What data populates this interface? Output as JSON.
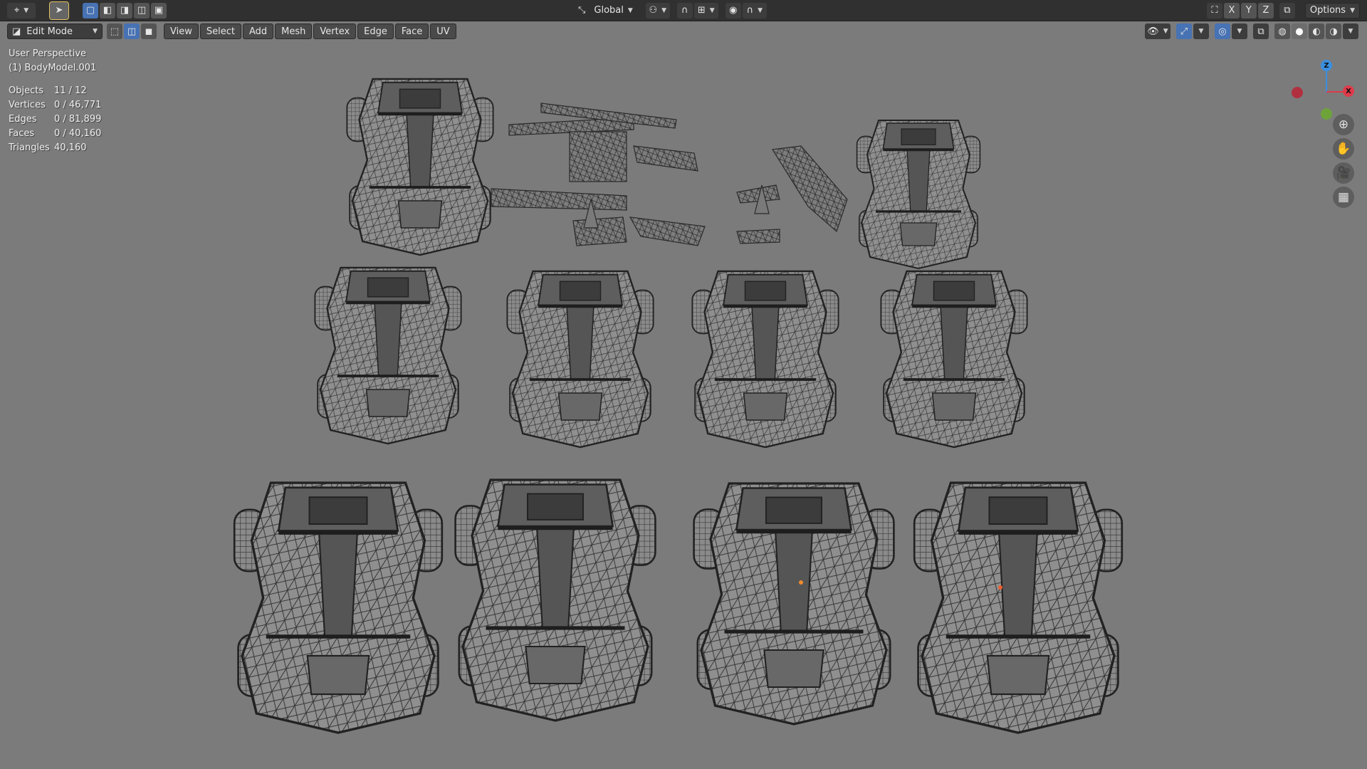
{
  "app": {
    "topbar": {
      "transform_orientation": "Global",
      "axes": [
        "X",
        "Y",
        "Z"
      ],
      "options_label": "Options"
    },
    "header": {
      "mode": "Edit Mode",
      "menus": [
        "View",
        "Select",
        "Add",
        "Mesh",
        "Vertex",
        "Edge",
        "Face",
        "UV"
      ]
    },
    "viewport": {
      "perspective_label": "User Perspective",
      "active_object": "(1) BodyModel.001",
      "stats": [
        {
          "key": "Objects",
          "value": "11 / 12"
        },
        {
          "key": "Vertices",
          "value": "0 / 46,771"
        },
        {
          "key": "Edges",
          "value": "0 / 81,899"
        },
        {
          "key": "Faces",
          "value": "0 / 40,160"
        },
        {
          "key": "Triangles",
          "value": "40,160"
        }
      ],
      "gizmo": {
        "x": "X",
        "y": "Y",
        "z": "Z"
      },
      "nav_tools": [
        "zoom-icon",
        "hand-pan-icon",
        "camera-icon",
        "grid-ortho-icon"
      ]
    },
    "colors": {
      "background": "#7b7b7b",
      "header": "#303030",
      "accent_blue": "#4772b3",
      "wire": "#2a2a2a",
      "body_fill": "#8d8d8d",
      "axis_x": "#e03a4a",
      "axis_y": "#7ab13a",
      "axis_z": "#3b8fe0"
    }
  }
}
